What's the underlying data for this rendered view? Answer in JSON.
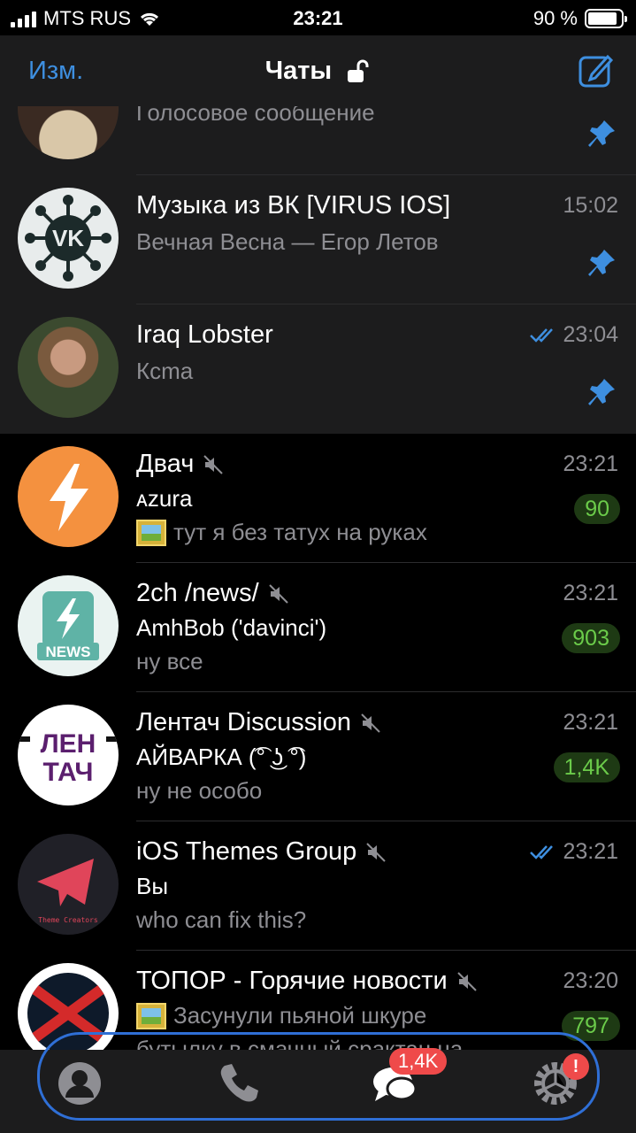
{
  "status_bar": {
    "carrier": "MTS RUS",
    "time": "23:21",
    "battery": "90 %"
  },
  "nav": {
    "edit_label": "Изм.",
    "title": "Чаты"
  },
  "chats": [
    {
      "name": "",
      "preview": "Голосовое сообщение",
      "time": "",
      "pinned": true
    },
    {
      "name": "Музыка из ВК [VIRUS IOS]",
      "preview": "Вечная Весна — Егор Летов",
      "time": "15:02",
      "pinned": true
    },
    {
      "name": "Iraq Lobster",
      "preview": "Ксmа",
      "time": "23:04",
      "pinned": true,
      "read": true
    },
    {
      "name": "Двач",
      "sender": "ᴀzura",
      "preview": "тут я без татух на руках",
      "time": "23:21",
      "badge": "90",
      "muted": true
    },
    {
      "name": "2ch /news/",
      "sender": "AmhBob ('davinci')",
      "preview": "ну все",
      "time": "23:21",
      "badge": "903",
      "muted": true
    },
    {
      "name": "Лентач Discussion",
      "sender": "АЙВАРКА (͡° ͜ʖ ͡°)",
      "preview": "ну не особо",
      "time": "23:21",
      "badge": "1,4K",
      "muted": true
    },
    {
      "name": "iOS Themes Group",
      "sender": "Вы",
      "preview": "who can fix this?",
      "time": "23:21",
      "muted": true,
      "read": true
    },
    {
      "name": "ТОПОР - Горячие новости",
      "preview": "Засунули пьяной шкуре",
      "preview2": "бутылку в смачный срактан на",
      "time": "23:20",
      "badge": "797",
      "muted": true
    }
  ],
  "avatars": {
    "theme_creators_text": "Theme Creators",
    "news_text": "NEWS",
    "lentach_line1": "ЛЕН",
    "lentach_line2": "ТАЧ"
  },
  "tab_bar": {
    "chats_badge": "1,4K",
    "settings_badge": "!"
  },
  "colors": {
    "accent": "#3e8fe0",
    "badge_bg": "#1e3a14",
    "badge_text": "#6bcb4a",
    "red": "#ef4a4a"
  }
}
